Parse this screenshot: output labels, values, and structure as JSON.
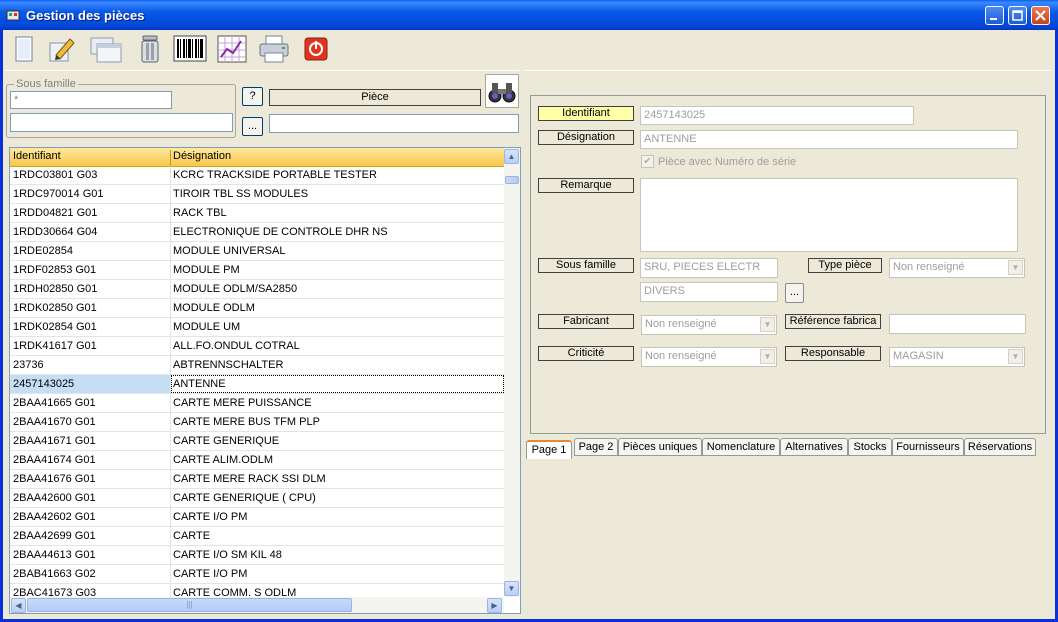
{
  "window": {
    "title": "Gestion des pièces"
  },
  "toolbar": {
    "tools": [
      "new-document-icon",
      "edit-pencil-icon",
      "duplicate-windows-icon",
      "trash-can-icon",
      "barcode-icon",
      "nomenclature-chart-icon",
      "printer-icon",
      "power-exit-icon"
    ]
  },
  "filters": {
    "sous_famille_label": "Sous famille",
    "sous_famille_value": "*",
    "sous_famille_detail": "",
    "help_button": "?",
    "browse_button": "...",
    "piece_label": "Pièce",
    "piece_value": ""
  },
  "grid": {
    "columns": [
      "Identifiant",
      "Désignation"
    ],
    "rows": [
      {
        "id": "1RDC03801 G03",
        "des": "KCRC TRACKSIDE PORTABLE TESTER"
      },
      {
        "id": "1RDC970014 G01",
        "des": "TIROIR TBL SS MODULES"
      },
      {
        "id": "1RDD04821 G01",
        "des": "RACK TBL"
      },
      {
        "id": "1RDD30664 G04",
        "des": "ELECTRONIQUE DE CONTROLE  DHR  NS"
      },
      {
        "id": "1RDE02854",
        "des": "MODULE UNIVERSAL"
      },
      {
        "id": "1RDF02853 G01",
        "des": "MODULE PM"
      },
      {
        "id": "1RDH02850 G01",
        "des": "MODULE ODLM/SA2850"
      },
      {
        "id": "1RDK02850 G01",
        "des": "MODULE ODLM"
      },
      {
        "id": "1RDK02854 G01",
        "des": "MODULE UM"
      },
      {
        "id": "1RDK41617 G01",
        "des": "ALL.FO.ONDUL COTRAL"
      },
      {
        "id": "23736",
        "des": "ABTRENNSCHALTER"
      },
      {
        "id": "2457143025",
        "des": "ANTENNE"
      },
      {
        "id": "2BAA41665 G01",
        "des": "CARTE MERE PUISSANCE"
      },
      {
        "id": "2BAA41670 G01",
        "des": "CARTE MERE BUS TFM PLP"
      },
      {
        "id": "2BAA41671 G01",
        "des": "CARTE GENERIQUE"
      },
      {
        "id": "2BAA41674 G01",
        "des": "CARTE ALIM.ODLM"
      },
      {
        "id": "2BAA41676 G01",
        "des": "CARTE MERE RACK SSI DLM"
      },
      {
        "id": "2BAA42600 G01",
        "des": "CARTE GENERIQUE ( CPU)"
      },
      {
        "id": "2BAA42602 G01",
        "des": "CARTE I/O  PM"
      },
      {
        "id": "2BAA42699 G01",
        "des": "CARTE"
      },
      {
        "id": "2BAA44613 G01",
        "des": "CARTE I/O  SM KIL 48"
      },
      {
        "id": "2BAB41663 G02",
        "des": "CARTE I/O PM"
      },
      {
        "id": "2BAC41673 G03",
        "des": "CARTE COMM. S ODLM"
      }
    ],
    "selected_index": 11
  },
  "detail": {
    "identifiant_label": "Identifiant",
    "identifiant_value": "2457143025",
    "designation_label": "Désignation",
    "designation_value": "ANTENNE",
    "serial_label": "Pièce avec Numéro de série",
    "remarque_label": "Remarque",
    "remarque_value": "",
    "sous_famille_label": "Sous famille",
    "sous_famille_value": "SRU, PIECES ELECTR",
    "sous_famille_sub": "DIVERS",
    "browse_button": "...",
    "type_piece_label": "Type pièce",
    "type_piece_value": "Non renseigné",
    "fabricant_label": "Fabricant",
    "fabricant_value": "Non renseigné",
    "ref_fabrica_label": "Référence fabrica",
    "ref_fabrica_value": "",
    "criticite_label": "Criticité",
    "criticite_value": "Non renseigné",
    "responsable_label": "Responsable",
    "responsable_value": "MAGASIN"
  },
  "tabs": [
    "Page 1",
    "Page 2",
    "Pièces uniques",
    "Nomenclature",
    "Alternatives",
    "Stocks",
    "Fournisseurs",
    "Réservations"
  ],
  "active_tab": 0
}
